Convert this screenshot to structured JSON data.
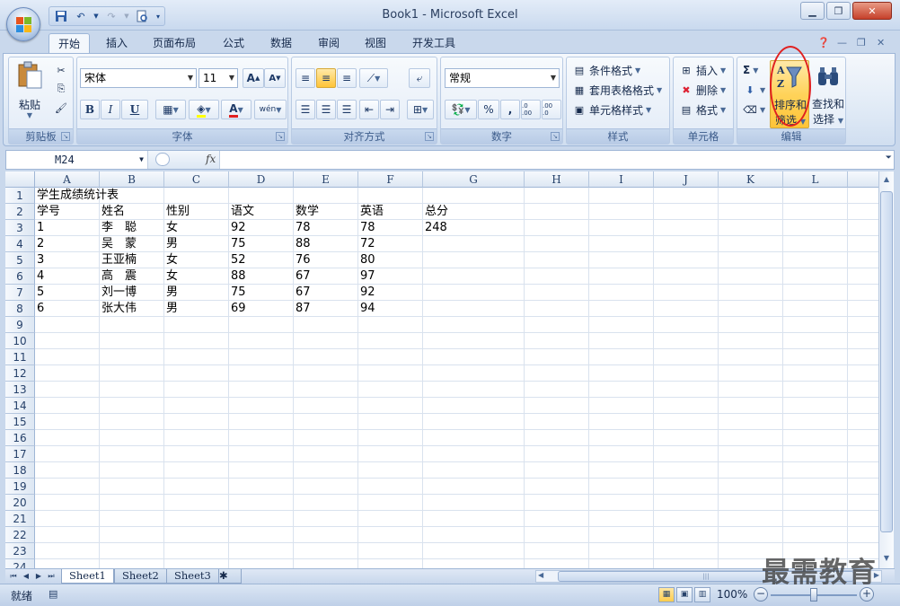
{
  "window": {
    "title": "Book1 - Microsoft Excel",
    "min_icon": "minimize-icon",
    "max_icon": "restore-icon",
    "close_label": "✕"
  },
  "ribbon_tabs": [
    {
      "label": "开始"
    },
    {
      "label": "插入"
    },
    {
      "label": "页面布局"
    },
    {
      "label": "公式"
    },
    {
      "label": "数据"
    },
    {
      "label": "审阅"
    },
    {
      "label": "视图"
    },
    {
      "label": "开发工具"
    }
  ],
  "groups": {
    "clipboard": {
      "label": "剪贴板",
      "paste": "粘贴"
    },
    "font": {
      "label": "字体",
      "font_name": "宋体",
      "font_size": "11",
      "bold": "B",
      "italic": "I",
      "underline": "U",
      "grow": "A",
      "shrink": "A",
      "color_a": "A",
      "phonetic": "wén"
    },
    "alignment": {
      "label": "对齐方式"
    },
    "number": {
      "label": "数字",
      "format": "常规",
      "percent": "%",
      "comma": ",",
      "inc_dec": ".0 .00",
      "dec_dec": ".00 .0"
    },
    "styles": {
      "label": "样式",
      "cond": "条件格式",
      "table": "套用表格格式",
      "cell": "单元格样式"
    },
    "cells": {
      "label": "单元格",
      "insert": "插入",
      "delete": "删除",
      "format": "格式"
    },
    "editing": {
      "label": "编辑",
      "sum": "Σ",
      "sort_l1": "排序和",
      "sort_l2": "筛选",
      "find_l1": "查找和",
      "find_l2": "选择"
    }
  },
  "formula_bar": {
    "name_box": "M24",
    "fx": "fx",
    "formula": ""
  },
  "columns": [
    "A",
    "B",
    "C",
    "D",
    "E",
    "F",
    "G",
    "H",
    "I",
    "J",
    "K",
    "L"
  ],
  "rows": [
    "1",
    "2",
    "3",
    "4",
    "5",
    "6",
    "7",
    "8",
    "9",
    "10",
    "11",
    "12",
    "13",
    "14",
    "15",
    "16",
    "17",
    "18",
    "19",
    "20",
    "21",
    "22",
    "23",
    "24"
  ],
  "cells": [
    [
      "学生成绩统计表",
      "",
      "",
      "",
      "",
      "",
      ""
    ],
    [
      "学号",
      "姓名",
      "性别",
      "语文",
      "数学",
      "英语",
      "总分"
    ],
    [
      "1",
      "李　聪",
      "女",
      "92",
      "78",
      "78",
      "248"
    ],
    [
      "2",
      "吴　蒙",
      "男",
      "75",
      "88",
      "72",
      ""
    ],
    [
      "3",
      "王亚楠",
      "女",
      "52",
      "76",
      "80",
      ""
    ],
    [
      "4",
      "高　震",
      "女",
      "88",
      "67",
      "97",
      ""
    ],
    [
      "5",
      "刘一博",
      "男",
      "75",
      "67",
      "92",
      ""
    ],
    [
      "6",
      "张大伟",
      "男",
      "69",
      "87",
      "94",
      ""
    ]
  ],
  "sheets": [
    "Sheet1",
    "Sheet2",
    "Sheet3"
  ],
  "status": {
    "ready": "就绪",
    "zoom": "100%"
  },
  "watermark": "最需教育",
  "colors": {
    "accent": "#ffc438",
    "annotation": "#e02020"
  }
}
